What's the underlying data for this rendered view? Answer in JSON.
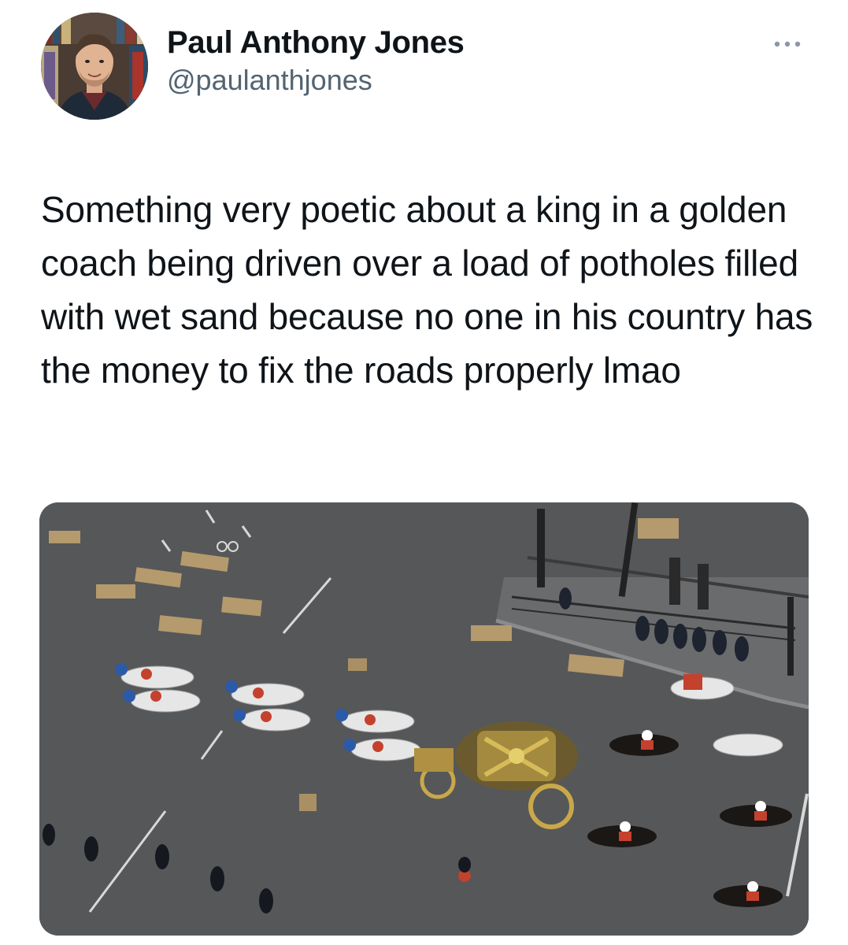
{
  "tweet": {
    "author": {
      "display_name": "Paul Anthony Jones",
      "handle": "@paulanthjones"
    },
    "more_icon": "more-horizontal-icon",
    "text": "Something very poetic about a king in a golden coach being driven over a load of potholes filled with wet sand because no one in his country has the money to fix the roads properly lmao",
    "media": {
      "kind": "photo"
    }
  }
}
